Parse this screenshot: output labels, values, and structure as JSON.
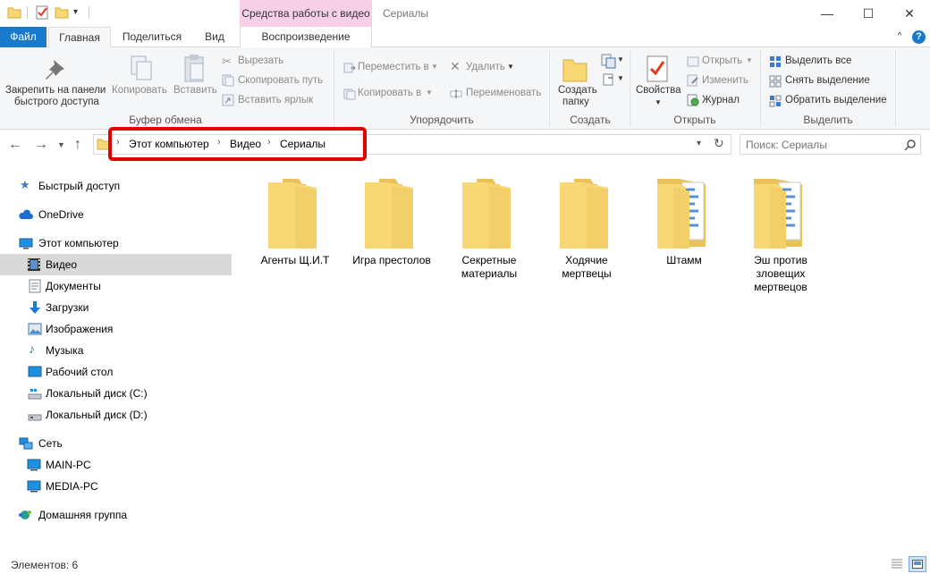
{
  "window": {
    "context_tab_title": "Средства работы с видео",
    "title": "Сериалы",
    "minimize": "—",
    "maximize": "☐",
    "close": "✕"
  },
  "tabs": {
    "file": "Файл",
    "home": "Главная",
    "share": "Поделиться",
    "view": "Вид",
    "playback": "Воспроизведение",
    "collapse_ribbon": "^",
    "help": "?"
  },
  "ribbon": {
    "clipboard": {
      "pin_line1": "Закрепить на панели",
      "pin_line2": "быстрого доступа",
      "copy": "Копировать",
      "paste": "Вставить",
      "cut": "Вырезать",
      "copy_path": "Скопировать путь",
      "paste_shortcut": "Вставить ярлык",
      "group": "Буфер обмена"
    },
    "organize": {
      "move_to": "Переместить в",
      "copy_to": "Копировать в",
      "delete": "Удалить",
      "rename": "Переименовать",
      "group": "Упорядочить"
    },
    "new": {
      "new_folder_line1": "Создать",
      "new_folder_line2": "папку",
      "group": "Создать"
    },
    "open": {
      "properties": "Свойства",
      "open": "Открыть",
      "edit": "Изменить",
      "history": "Журнал",
      "group": "Открыть"
    },
    "select": {
      "select_all": "Выделить все",
      "select_none": "Снять выделение",
      "invert": "Обратить выделение",
      "group": "Выделить"
    }
  },
  "address": {
    "crumbs": [
      "Этот компьютер",
      "Видео",
      "Сериалы"
    ],
    "search_placeholder": "Поиск: Сериалы"
  },
  "sidebar": {
    "items": [
      {
        "label": "Быстрый доступ"
      },
      {
        "label": "OneDrive"
      },
      {
        "label": "Этот компьютер"
      },
      {
        "label": "Видео"
      },
      {
        "label": "Документы"
      },
      {
        "label": "Загрузки"
      },
      {
        "label": "Изображения"
      },
      {
        "label": "Музыка"
      },
      {
        "label": "Рабочий стол"
      },
      {
        "label": "Локальный диск (C:)"
      },
      {
        "label": "Локальный диск (D:)"
      },
      {
        "label": "Сеть"
      },
      {
        "label": "MAIN-PC"
      },
      {
        "label": "MEDIA-PC"
      },
      {
        "label": "Домашняя группа"
      }
    ]
  },
  "folders": [
    {
      "label": "Агенты Щ.И.Т"
    },
    {
      "label": "Игра престолов"
    },
    {
      "label": "Секретные материалы"
    },
    {
      "label": "Ходячие мертвецы"
    },
    {
      "label": "Штамм"
    },
    {
      "label": "Эш против зловещих мертвецов"
    }
  ],
  "status": {
    "items_count": "Элементов: 6"
  },
  "colors": {
    "accent": "#1979ca",
    "context_tab": "#f7d0e6",
    "folder": "#f8d775",
    "highlight": "#e30000",
    "selected": "#d9d9d9"
  }
}
